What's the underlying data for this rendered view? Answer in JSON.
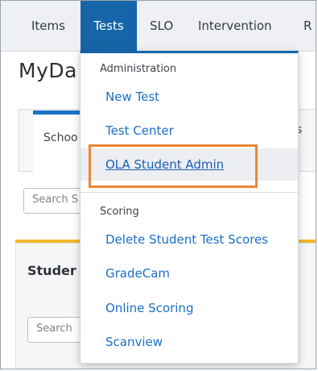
{
  "nav": {
    "items": [
      {
        "label": "Items"
      },
      {
        "label": "Tests"
      },
      {
        "label": "SLO"
      },
      {
        "label": "Intervention"
      },
      {
        "label": "R"
      }
    ]
  },
  "page": {
    "title": "MyDa",
    "tab_left": "Schoo",
    "tab_right": "s",
    "search_top_placeholder": "Search S",
    "panel_title": "Studer",
    "search_bottom_placeholder": "Search"
  },
  "dropdown": {
    "admin_header": "Administration",
    "admin_items": [
      {
        "label": "New Test"
      },
      {
        "label": "Test Center"
      },
      {
        "label": "OLA Student Admin"
      }
    ],
    "scoring_header": "Scoring",
    "scoring_items": [
      {
        "label": "Delete Student Test Scores"
      },
      {
        "label": "GradeCam"
      },
      {
        "label": "Online Scoring"
      },
      {
        "label": "Scanview"
      }
    ]
  },
  "colors": {
    "nav_active": "#1565a8",
    "link": "#1a6fc8",
    "highlight_box": "#e98734",
    "panel_accent": "#f4b829"
  }
}
